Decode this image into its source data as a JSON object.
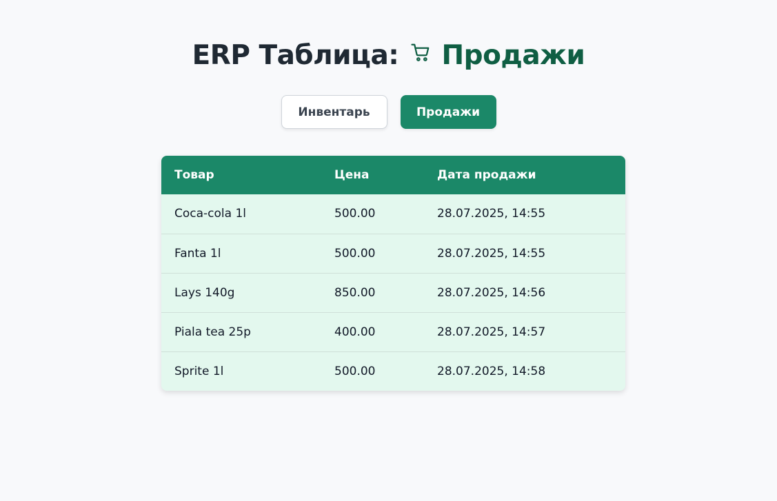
{
  "header": {
    "title_prefix": "ERP Таблица:",
    "title_section": "Продажи",
    "icon": "cart-icon"
  },
  "tabs": [
    {
      "label": "Инвентарь",
      "active": false
    },
    {
      "label": "Продажи",
      "active": true
    }
  ],
  "colors": {
    "accent": "#1b8868",
    "title_accent": "#0f5e43",
    "row_background": "#e3f8ee",
    "page_background": "#f8f9fb"
  },
  "table": {
    "columns": [
      "Товар",
      "Цена",
      "Дата продажи"
    ],
    "rows": [
      [
        "Coca-cola 1l",
        "500.00",
        "28.07.2025, 14:55"
      ],
      [
        "Fanta 1l",
        "500.00",
        "28.07.2025, 14:55"
      ],
      [
        "Lays 140g",
        "850.00",
        "28.07.2025, 14:56"
      ],
      [
        "Piala tea 25p",
        "400.00",
        "28.07.2025, 14:57"
      ],
      [
        "Sprite 1l",
        "500.00",
        "28.07.2025, 14:58"
      ]
    ]
  }
}
